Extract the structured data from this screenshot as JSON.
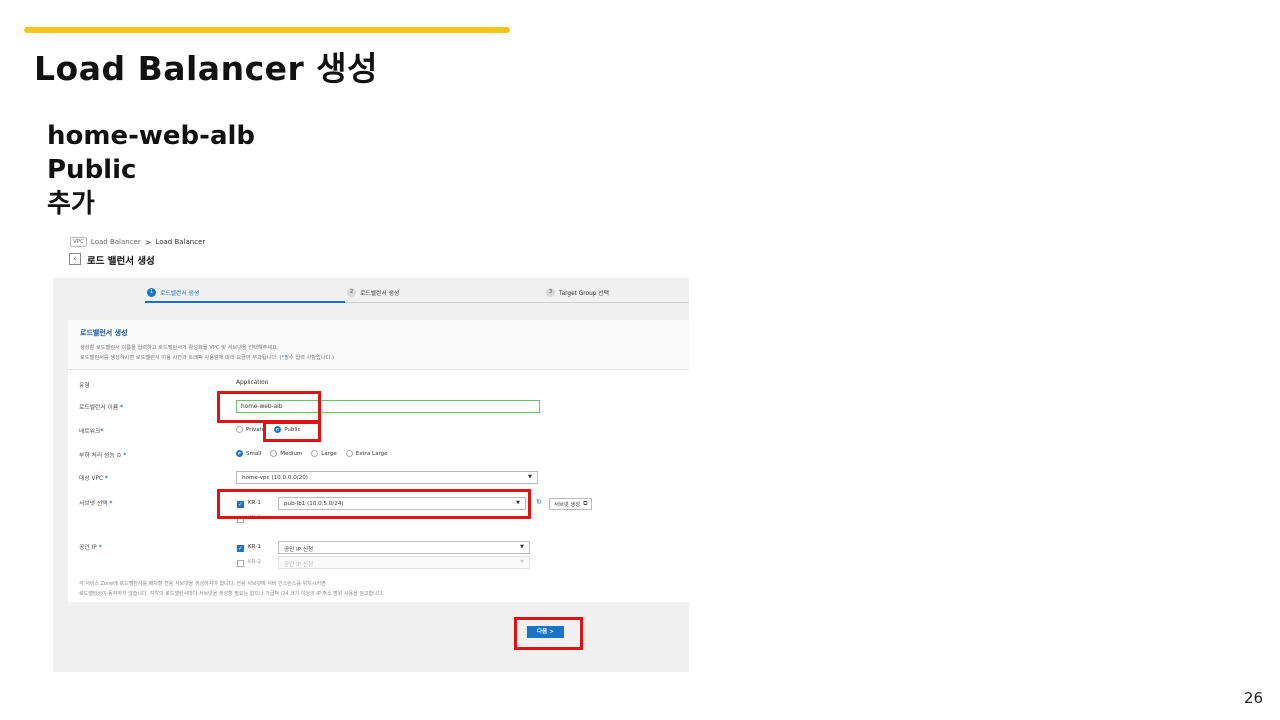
{
  "slide": {
    "title": "Load Balancer 생성",
    "notes": [
      "home-web-alb",
      "Public",
      "추가"
    ],
    "page_number": "26",
    "accent_color": "#f5c518",
    "highlight_color": "#dd1414"
  },
  "console": {
    "breadcrumb": {
      "chip": "VPC",
      "items": [
        "Load Balancer",
        "Load Balancer"
      ],
      "separator": ">"
    },
    "page_title": "로드 밸런서 생성",
    "steps": [
      {
        "num": "1",
        "label": "로드밸런서 생성"
      },
      {
        "num": "2",
        "label": "로드밸런서 생성"
      },
      {
        "num": "3",
        "label": "Target Group 선택"
      }
    ],
    "section": {
      "title": "로드밸런서 생성",
      "desc_line1": "생성할 로드밸런서 이름을 입력하고 로드밸런서가 활성화될 VPC 및 서브넷을 선택해주세요.",
      "desc_line2": "로드밸런서를 생성하시면 로드밸런서 이용 시간과 트래픽 사용량에 따라 요금이 부과됩니다. (",
      "desc_line2_mark": "*",
      "desc_line2_tail": "필수 입력 사항입니다.)"
    },
    "form": {
      "type": {
        "label": "유형",
        "value": "Application"
      },
      "name": {
        "label": "로드밸런서 이름",
        "value": "home-web-alb"
      },
      "network": {
        "label": "네트워크",
        "options": [
          "Private",
          "Public"
        ],
        "selected": "Public"
      },
      "performance": {
        "label": "부하 처리 성능",
        "options": [
          "Small",
          "Medium",
          "Large",
          "Extra Large"
        ],
        "selected": "Small"
      },
      "vpc": {
        "label": "대상 VPC",
        "value": "home-vpc (10.0.0.0/20)"
      },
      "subnet": {
        "label": "서브넷 선택",
        "zones": [
          {
            "name": "KR-1",
            "checked": true,
            "value": "pub-lb1 (10.0.5.0/24)"
          },
          {
            "name": "KR-2",
            "checked": false,
            "value": ""
          }
        ],
        "create_label": "서브넷 생성"
      },
      "public_ip": {
        "label": "공인 IP",
        "zones": [
          {
            "name": "KR-1",
            "checked": true,
            "value": "공인 IP 신청"
          },
          {
            "name": "KR-2",
            "checked": false,
            "value": "공인 IP 신청"
          }
        ]
      },
      "required_mark": "*",
      "footnote_line1": "각 서비스 Zone에 로드밸런서를 배치할 전용 서브넷을 생성하셔야 합니다. 전용 서브넷에 서버 인스턴스를 위치시키면",
      "footnote_line2": "로드밸런싱이 동작하지 않습니다. 각각의 로드밸런서마다 서브넷을 생성할 필요는 없으나 가급적 /24 크기 이상의 IP 주소 범위 사용을 권고합니다."
    },
    "next_button": "다음",
    "next_arrow": ">",
    "primary_color": "#1a73c8"
  }
}
